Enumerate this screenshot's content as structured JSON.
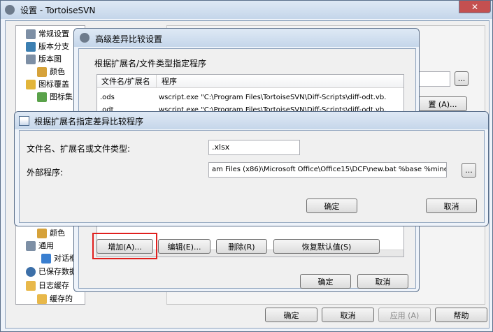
{
  "main_window": {
    "title": "设置 - TortoiseSVN",
    "tree": [
      "常规设置",
      "版本分支",
      "版本图",
      "颜色",
      "图标覆盖",
      "图标集",
      "颜色",
      "通用",
      "对话框",
      "已保存数据",
      "日志缓存",
      "缓存的"
    ],
    "buttons": {
      "ok": "确定",
      "cancel": "取消",
      "apply": "应用 (A)",
      "help": "帮助"
    },
    "right_button": "置 (A)..."
  },
  "advanced_dialog": {
    "title": "高级差异比较设置",
    "group_label": "根据扩展名/文件类型指定程序",
    "columns": [
      "文件名/扩展名",
      "程序"
    ],
    "rows": [
      {
        "ext": ".ods",
        "program": "wscript.exe \"C:\\Program Files\\TortoiseSVN\\Diff-Scripts\\diff-odt.vb."
      },
      {
        "ext": ".odt",
        "program": "wscript.exe \"C:\\Program Files\\TortoiseSVN\\Diff-Scripts\\diff-odt.vb."
      }
    ],
    "buttons": {
      "add": "增加(A)...",
      "edit": "编辑(E)...",
      "delete": "删除(R)",
      "restore": "恢复默认值(S)",
      "ok": "确定",
      "cancel": "取消"
    }
  },
  "ext_dialog": {
    "title": "根据扩展名指定差异比较程序",
    "ext_label": "文件名、扩展名或文件类型:",
    "ext_value": ".xlsx",
    "program_label": "外部程序:",
    "program_value": "am Files (x86)\\Microsoft Office\\Office15\\DCF\\new.bat %base %mine",
    "browse": "...",
    "ok": "确定",
    "cancel": "取消"
  },
  "colors": {
    "highlight": "#e0201e",
    "accent": "#3c7fb1"
  }
}
